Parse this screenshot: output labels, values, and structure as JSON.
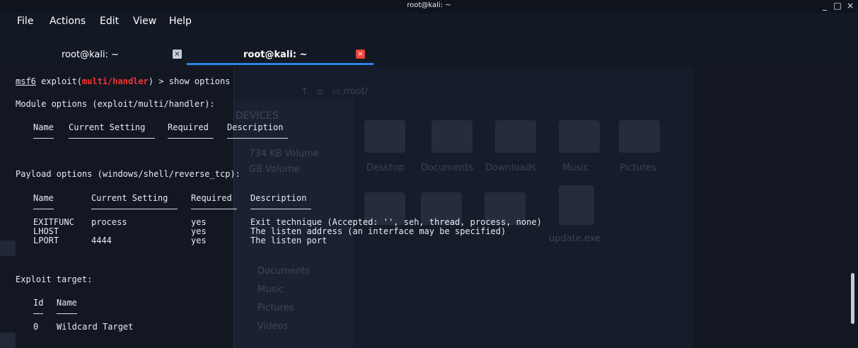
{
  "window": {
    "title": "root@kali: ~"
  },
  "menu": [
    "File",
    "Actions",
    "Edit",
    "View",
    "Help"
  ],
  "tabs": [
    {
      "label": "root@kali: ~",
      "active": false
    },
    {
      "label": "root@kali: ~",
      "active": true
    }
  ],
  "terminal": {
    "prompt": {
      "user": "msf6",
      "pre": " exploit(",
      "module": "multi/handler",
      "post": ") > ",
      "command": "show options"
    },
    "module_header": "Module options (exploit/multi/handler):",
    "module_columns": [
      "Name",
      "Current Setting",
      "Required",
      "Description"
    ],
    "payload_header": "Payload options (windows/shell/reverse_tcp):",
    "payload_columns": [
      "Name",
      "Current Setting",
      "Required",
      "Description"
    ],
    "payload_rows": [
      {
        "name": "EXITFUNC",
        "setting": "process",
        "required": "yes",
        "description": "Exit technique (Accepted: '', seh, thread, process, none)"
      },
      {
        "name": "LHOST",
        "setting": "",
        "required": "yes",
        "description": "The listen address (an interface may be specified)"
      },
      {
        "name": "LPORT",
        "setting": "4444",
        "required": "yes",
        "description": "The listen port"
      }
    ],
    "target_header": "Exploit target:",
    "target_columns": [
      "Id",
      "Name"
    ],
    "target_rows": [
      {
        "id": "0",
        "name": "Wildcard Target"
      }
    ]
  },
  "background": {
    "path": "/root/",
    "devices_label": "DEVICES",
    "volume_labels": [
      "734 KB Volume",
      "GB Volume"
    ],
    "folders": [
      "Desktop",
      "Documents",
      "Downloads",
      "Music",
      "Pictures"
    ],
    "side_items": [
      "Documents",
      "Music",
      "Pictures",
      "Videos"
    ],
    "file": "update.exe"
  },
  "colors": {
    "accent": "#2b83e8",
    "module_red": "#ff3030",
    "close_red": "#e8453c",
    "bg": "#121722"
  }
}
